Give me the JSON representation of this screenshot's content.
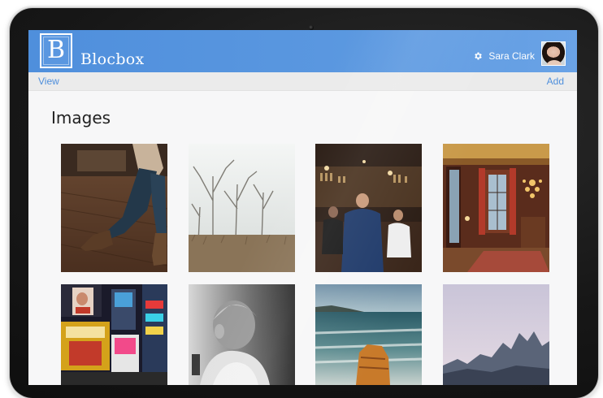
{
  "header": {
    "logo_letter": "B",
    "brand_name": "Blocbox",
    "settings_icon": "gear-icon",
    "user_name": "Sara Clark"
  },
  "subbar": {
    "view_label": "View",
    "add_label": "Add"
  },
  "main": {
    "title": "Images",
    "images": [
      {
        "subject": "walking-legs-boots"
      },
      {
        "subject": "misty-bare-trees"
      },
      {
        "subject": "man-in-bar"
      },
      {
        "subject": "ornate-room-chandelier"
      },
      {
        "subject": "times-square-night"
      },
      {
        "subject": "child-black-and-white"
      },
      {
        "subject": "ocean-rock-long-exposure"
      },
      {
        "subject": "mountain-peaks-dusk"
      }
    ]
  },
  "colors": {
    "header_blue": "#4f8fdc",
    "link_blue": "#4f8fdc",
    "subbar_gray": "#ebebeb"
  }
}
